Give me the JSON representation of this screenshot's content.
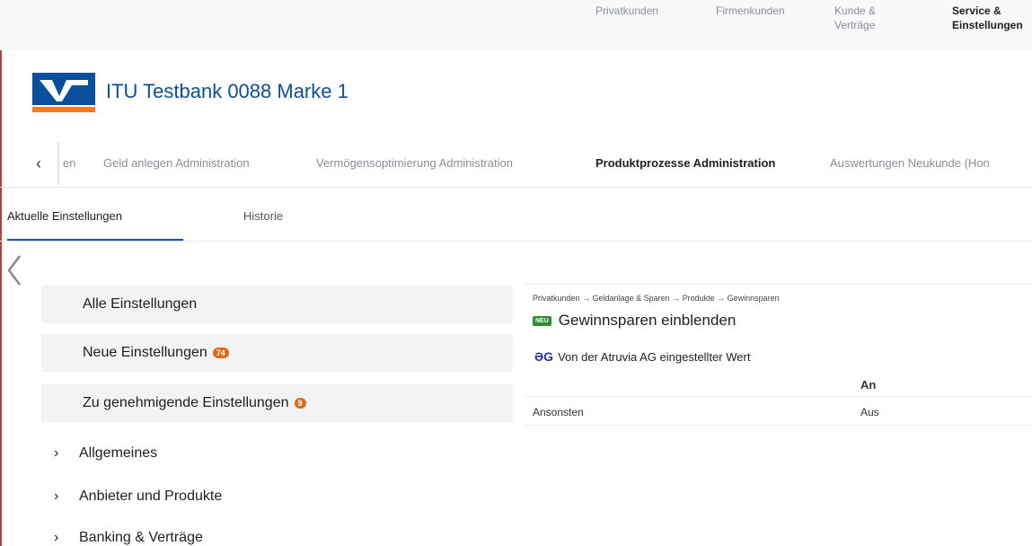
{
  "topnav": {
    "items": [
      {
        "label": "Privatkunden"
      },
      {
        "label": "Firmenkunden"
      },
      {
        "label": "Kunde & Verträge"
      },
      {
        "label": "Service & Einstellungen"
      }
    ]
  },
  "brand": {
    "name": "ITU Testbank 0088 Marke 1"
  },
  "subnav": {
    "back_icon": "chevron-left-icon",
    "items": [
      {
        "label": "en"
      },
      {
        "label": "Geld anlegen Administration"
      },
      {
        "label": "Vermögensoptimierung Administration"
      },
      {
        "label": "Produktprozesse Administration"
      },
      {
        "label": "Auswertungen Neukunde (Hon"
      }
    ]
  },
  "tabs": [
    {
      "label": "Aktuelle Einstellungen"
    },
    {
      "label": "Historie"
    }
  ],
  "menu": {
    "boxes": [
      {
        "label": "Alle Einstellungen",
        "badge": ""
      },
      {
        "label": "Neue Einstellungen",
        "badge": "74"
      },
      {
        "label": "Zu genehmigende Einstellungen",
        "badge": "9"
      }
    ],
    "groups": [
      {
        "label": "Allgemeines"
      },
      {
        "label": "Anbieter und Produkte"
      },
      {
        "label": "Banking & Verträge"
      }
    ]
  },
  "detail": {
    "breadcrumb": "Privatkunden → Geldanlage & Sparen → Produkte → Gewinnsparen",
    "new_badge": "NEU",
    "title": "Gewinnsparen einblenden",
    "provider_icon": "ƏG",
    "provider_text": "Von der Atruvia AG eingestellter Wert",
    "column_header": "An",
    "row_label": "Ansonsten",
    "row_value": "Aus"
  },
  "colors": {
    "accent": "#0a57b3",
    "brand_blue": "#0a4f9e",
    "badge": "#e06a1a",
    "new": "#2f8f2f"
  }
}
